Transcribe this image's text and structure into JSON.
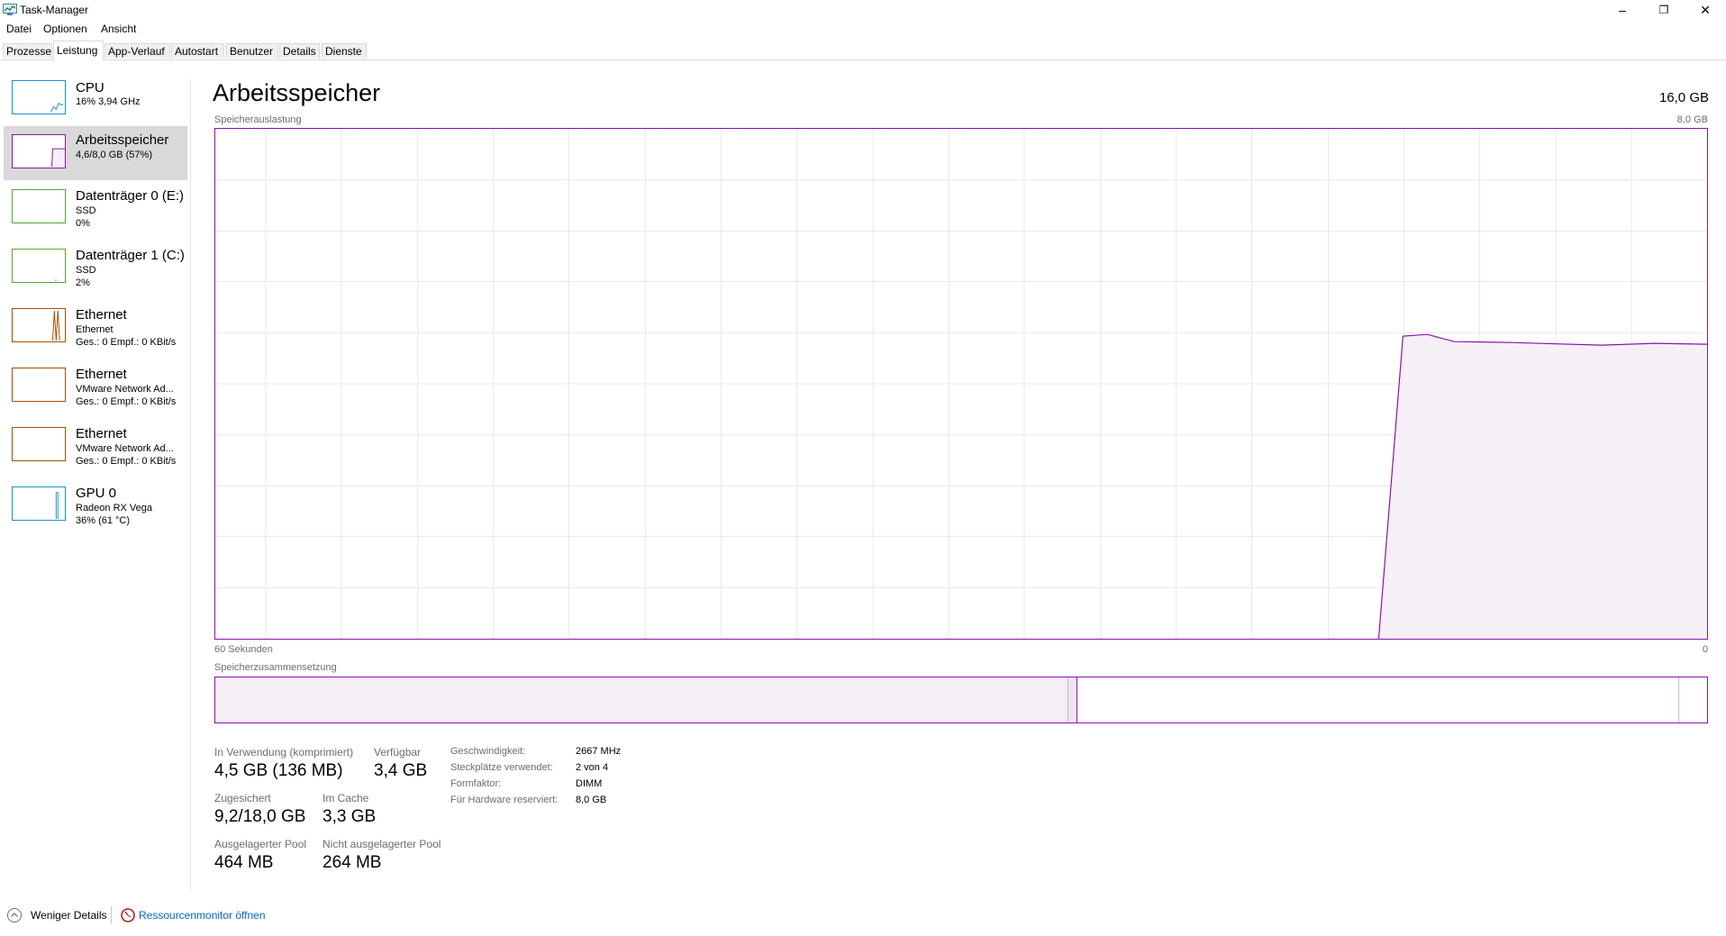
{
  "window": {
    "title": "Task-Manager",
    "controls": {
      "minimize": "–",
      "maximize": "❐",
      "close": "✕"
    }
  },
  "menu": [
    "Datei",
    "Optionen",
    "Ansicht"
  ],
  "tabs": [
    {
      "label": "Prozesse",
      "active": false
    },
    {
      "label": "Leistung",
      "active": true
    },
    {
      "label": "App-Verlauf",
      "active": false
    },
    {
      "label": "Autostart",
      "active": false
    },
    {
      "label": "Benutzer",
      "active": false
    },
    {
      "label": "Details",
      "active": false
    },
    {
      "label": "Dienste",
      "active": false
    }
  ],
  "sidebar": {
    "items": [
      {
        "title": "CPU",
        "lines": [
          "16% 3,94 GHz"
        ],
        "color": "#1c8ed2",
        "active": false
      },
      {
        "title": "Arbeitsspeicher",
        "lines": [
          "4,6/8,0 GB (57%)"
        ],
        "color": "#8b12ae",
        "active": true
      },
      {
        "title": "Datenträger 0 (E:)",
        "lines": [
          "SSD",
          "0%"
        ],
        "color": "#4daa31",
        "active": false
      },
      {
        "title": "Datenträger 1 (C:)",
        "lines": [
          "SSD",
          "2%"
        ],
        "color": "#4daa31",
        "active": false
      },
      {
        "title": "Ethernet",
        "lines": [
          "Ethernet",
          "Ges.: 0 Empf.: 0 KBit/s"
        ],
        "color": "#a74f01",
        "active": false
      },
      {
        "title": "Ethernet",
        "lines": [
          "VMware Network Ad...",
          "Ges.: 0 Empf.: 0 KBit/s"
        ],
        "color": "#a74f01",
        "active": false
      },
      {
        "title": "Ethernet",
        "lines": [
          "VMware Network Ad...",
          "Ges.: 0 Empf.: 0 KBit/s"
        ],
        "color": "#a74f01",
        "active": false
      },
      {
        "title": "GPU 0",
        "lines": [
          "Radeon RX Vega",
          "36% (61 °C)"
        ],
        "color": "#1c8ed2",
        "active": false
      }
    ]
  },
  "main": {
    "title": "Arbeitsspeicher",
    "total": "16,0 GB",
    "graph_label": "Speicherauslastung",
    "graph_max": "8,0 GB",
    "axis_left": "60 Sekunden",
    "axis_right": "0",
    "composition_label": "Speicherzusammensetzung",
    "stats": {
      "in_use_label": "In Verwendung (komprimiert)",
      "in_use_value": "4,5 GB (136 MB)",
      "available_label": "Verfügbar",
      "available_value": "3,4 GB",
      "committed_label": "Zugesichert",
      "committed_value": "9,2/18,0 GB",
      "cached_label": "Im Cache",
      "cached_value": "3,3 GB",
      "paged_label": "Ausgelagerter Pool",
      "paged_value": "464 MB",
      "nonpaged_label": "Nicht ausgelagerter Pool",
      "nonpaged_value": "264 MB"
    },
    "info": {
      "speed_label": "Geschwindigkeit:",
      "speed_value": "2667 MHz",
      "slots_label": "Steckplätze verwendet:",
      "slots_value": "2 von 4",
      "form_label": "Formfaktor:",
      "form_value": "DIMM",
      "reserved_label": "Für Hardware reserviert:",
      "reserved_value": "8,0 GB"
    }
  },
  "footer": {
    "fewer_details": "Weniger Details",
    "resource_monitor": "Ressourcenmonitor öffnen"
  },
  "accent_color": "#8b12ae",
  "link_color": "#0066cc"
}
